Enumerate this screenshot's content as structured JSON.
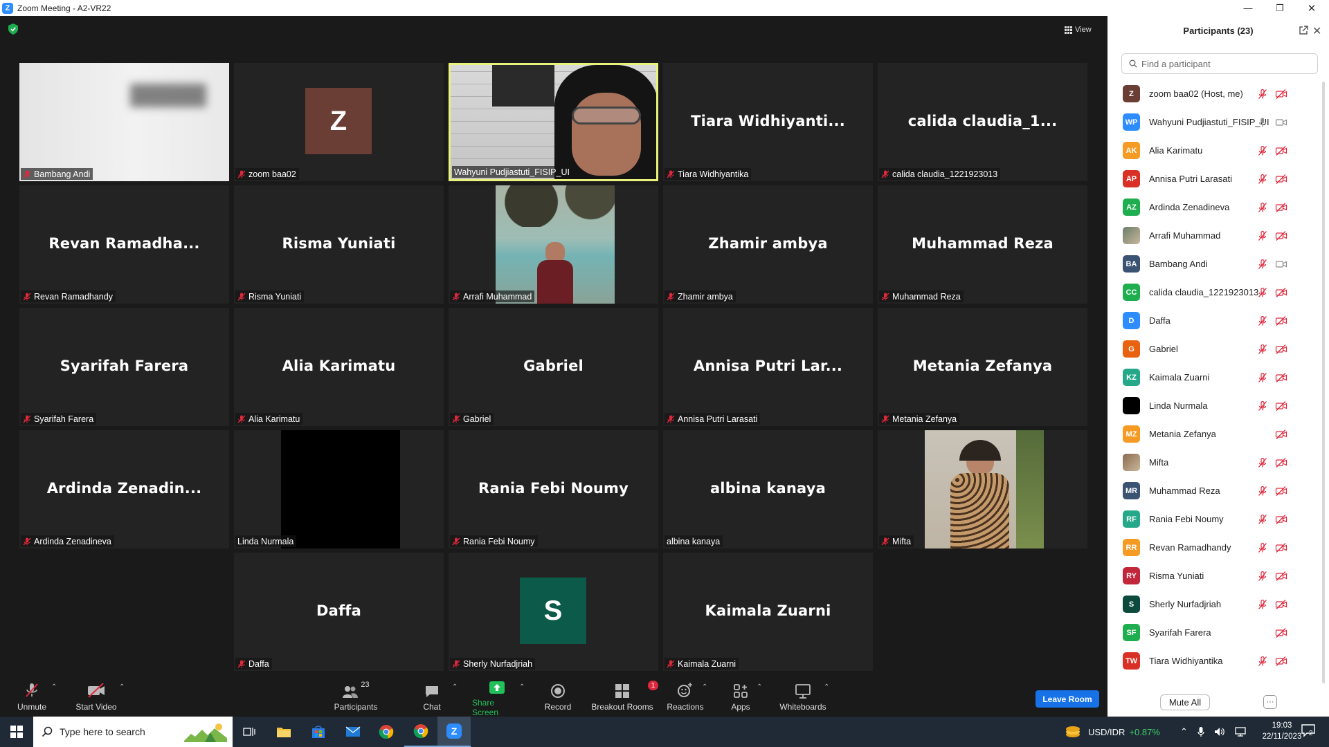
{
  "window": {
    "title": "Zoom Meeting - A2-VR22"
  },
  "view_label": "View",
  "tiles": [
    {
      "label": "Bambang Andi",
      "bigname": "",
      "kind": "blur",
      "muted": true
    },
    {
      "label": "zoom baa02",
      "bigname": "",
      "kind": "avatar",
      "letter": "Z",
      "color": "#6b3e35",
      "muted": true
    },
    {
      "label": "Wahyuni Pudjiastuti_FISIP_UI",
      "bigname": "",
      "kind": "video-woman",
      "muted": false,
      "active": true
    },
    {
      "label": "Tiara Widhiyantika",
      "bigname": "Tiara  Widhiyanti...",
      "kind": "name",
      "muted": true
    },
    {
      "label": "calida claudia_1221923013",
      "bigname": "calida  claudia_1...",
      "kind": "name",
      "muted": true
    },
    {
      "label": "Revan Ramadhandy",
      "bigname": "Revan  Ramadha...",
      "kind": "name",
      "muted": true
    },
    {
      "label": "Risma Yuniati",
      "bigname": "Risma Yuniati",
      "kind": "name",
      "muted": true
    },
    {
      "label": "Arrafi Muhammad",
      "bigname": "",
      "kind": "photo-lake",
      "muted": true
    },
    {
      "label": "Zhamir ambya",
      "bigname": "Zhamir ambya",
      "kind": "name",
      "muted": true
    },
    {
      "label": "Muhammad Reza",
      "bigname": "Muhammad Reza",
      "kind": "name",
      "muted": true
    },
    {
      "label": "Syarifah Farera",
      "bigname": "Syarifah Farera",
      "kind": "name",
      "muted": true
    },
    {
      "label": "Alia Karimatu",
      "bigname": "Alia Karimatu",
      "kind": "name",
      "muted": true
    },
    {
      "label": "Gabriel",
      "bigname": "Gabriel",
      "kind": "name",
      "muted": true
    },
    {
      "label": "Annisa Putri Larasati",
      "bigname": "Annisa Putri Lar...",
      "kind": "name",
      "muted": true
    },
    {
      "label": "Metania Zefanya",
      "bigname": "Metania Zefanya",
      "kind": "name",
      "muted": true
    },
    {
      "label": "Ardinda Zenadineva",
      "bigname": "Ardinda  Zenadin...",
      "kind": "name",
      "muted": true
    },
    {
      "label": "Linda Nurmala",
      "bigname": "",
      "kind": "black",
      "muted": false
    },
    {
      "label": "Rania Febi Noumy",
      "bigname": "Rania Febi Noumy",
      "kind": "name",
      "muted": true
    },
    {
      "label": "albina kanaya",
      "bigname": "albina kanaya",
      "kind": "name",
      "muted": false
    },
    {
      "label": "Mifta",
      "bigname": "",
      "kind": "photo-woman",
      "muted": true
    },
    {
      "label": "Daffa",
      "bigname": "Daffa",
      "kind": "name",
      "muted": true
    },
    {
      "label": "Sherly Nurfadjriah",
      "bigname": "",
      "kind": "avatar",
      "letter": "S",
      "color": "#0b5a4a",
      "muted": true
    },
    {
      "label": "Kaimala Zuarni",
      "bigname": "Kaimala Zuarni",
      "kind": "name",
      "muted": true
    }
  ],
  "toolbar": {
    "unmute": "Unmute",
    "start_video": "Start Video",
    "participants": "Participants",
    "participants_count": "23",
    "chat": "Chat",
    "share_screen": "Share Screen",
    "record": "Record",
    "breakout_rooms": "Breakout Rooms",
    "breakout_badge": "1",
    "reactions": "Reactions",
    "apps": "Apps",
    "whiteboards": "Whiteboards",
    "leave_room": "Leave Room"
  },
  "panel": {
    "title": "Participants (23)",
    "search_placeholder": "Find a participant",
    "mute_all": "Mute All",
    "more": "···",
    "participants": [
      {
        "initials": "Z",
        "name": "zoom baa02 (Host, me)",
        "color": "#6b3e35",
        "mic": "off",
        "cam": "off"
      },
      {
        "initials": "WP",
        "name": "Wahyuni Pudjiastuti_FISIP_UI",
        "color": "#2d8cff",
        "mic": "on",
        "cam": "on"
      },
      {
        "initials": "AK",
        "name": "Alia Karimatu",
        "color": "#f59a23",
        "mic": "off",
        "cam": "off"
      },
      {
        "initials": "AP",
        "name": "Annisa Putri Larasati",
        "color": "#d93025",
        "mic": "off",
        "cam": "off"
      },
      {
        "initials": "AZ",
        "name": "Ardinda Zenadineva",
        "color": "#1fae4f",
        "mic": "off",
        "cam": "off"
      },
      {
        "initials": "",
        "name": "Arrafi Muhammad",
        "color": "#6a7d6a",
        "mic": "off",
        "cam": "off",
        "photo": true
      },
      {
        "initials": "BA",
        "name": "Bambang Andi",
        "color": "#3b5373",
        "mic": "off",
        "cam": "on"
      },
      {
        "initials": "CC",
        "name": "calida claudia_1221923013",
        "color": "#1fae4f",
        "mic": "off",
        "cam": "off"
      },
      {
        "initials": "D",
        "name": "Daffa",
        "color": "#2d8cff",
        "mic": "off",
        "cam": "off"
      },
      {
        "initials": "G",
        "name": "Gabriel",
        "color": "#e8620f",
        "mic": "off",
        "cam": "off"
      },
      {
        "initials": "KZ",
        "name": "Kaimala Zuarni",
        "color": "#25a88a",
        "mic": "off",
        "cam": "off"
      },
      {
        "initials": "",
        "name": "Linda Nurmala",
        "color": "#000000",
        "mic": "off",
        "cam": "off"
      },
      {
        "initials": "MZ",
        "name": "Metania Zefanya",
        "color": "#f59a23",
        "mic": "none",
        "cam": "off"
      },
      {
        "initials": "",
        "name": "Mifta",
        "color": "#8a6a50",
        "mic": "off",
        "cam": "off",
        "photo": true
      },
      {
        "initials": "MR",
        "name": "Muhammad Reza",
        "color": "#3b5373",
        "mic": "off",
        "cam": "off"
      },
      {
        "initials": "RF",
        "name": "Rania Febi Noumy",
        "color": "#25a88a",
        "mic": "off",
        "cam": "off"
      },
      {
        "initials": "RR",
        "name": "Revan Ramadhandy",
        "color": "#f59a23",
        "mic": "off",
        "cam": "off"
      },
      {
        "initials": "RY",
        "name": "Risma Yuniati",
        "color": "#c2263a",
        "mic": "off",
        "cam": "off"
      },
      {
        "initials": "S",
        "name": "Sherly Nurfadjriah",
        "color": "#0b4a3c",
        "mic": "off",
        "cam": "off"
      },
      {
        "initials": "SF",
        "name": "Syarifah Farera",
        "color": "#1fae4f",
        "mic": "none",
        "cam": "off"
      },
      {
        "initials": "TW",
        "name": "Tiara Widhiyantika",
        "color": "#d93025",
        "mic": "off",
        "cam": "off"
      }
    ]
  },
  "taskbar": {
    "search_placeholder": "Type here to search",
    "ticker": "USD/IDR",
    "ticker_change": "+0.87%",
    "time": "19:03",
    "date": "22/11/2023",
    "notif_count": "2"
  },
  "colors": {
    "accent_blue": "#1772e8",
    "share_green": "#22c05a",
    "mute_red": "#e0283c",
    "active_border": "#e9f27a"
  }
}
